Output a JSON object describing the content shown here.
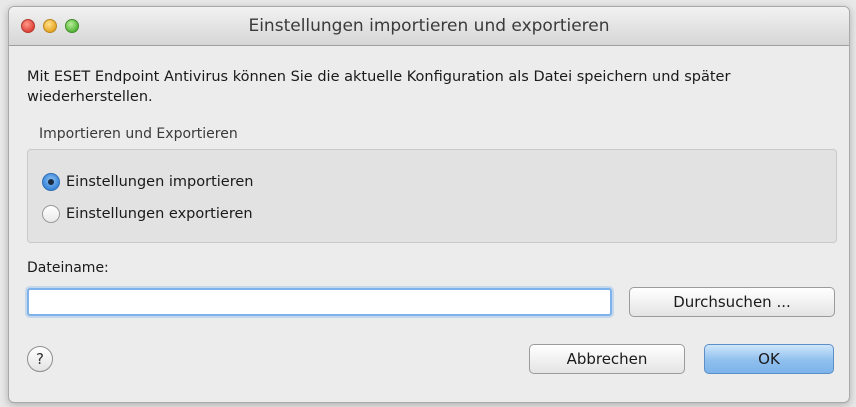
{
  "window": {
    "title": "Einstellungen importieren und exportieren"
  },
  "description": "Mit ESET Endpoint Antivirus können Sie die aktuelle Konfiguration als Datei speichern und später wiederherstellen.",
  "group": {
    "label": "Importieren und Exportieren",
    "options": [
      {
        "label": "Einstellungen importieren",
        "selected": true
      },
      {
        "label": "Einstellungen exportieren",
        "selected": false
      }
    ]
  },
  "filename": {
    "label": "Dateiname:",
    "value": "",
    "browse_label": "Durchsuchen ..."
  },
  "footer": {
    "help_glyph": "?",
    "cancel_label": "Abbrechen",
    "ok_label": "OK"
  }
}
